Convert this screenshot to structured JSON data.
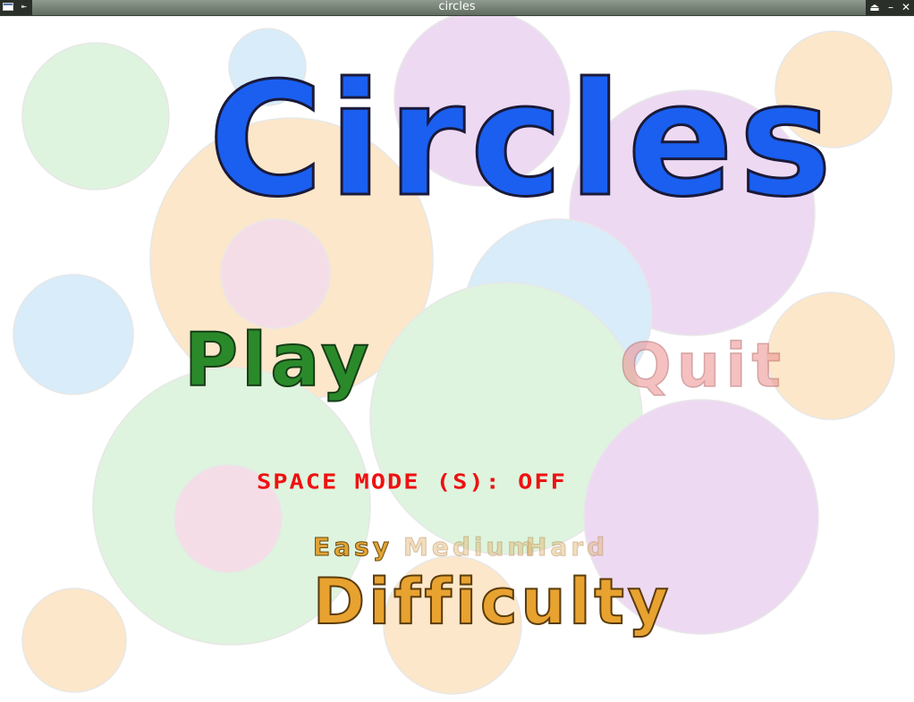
{
  "window": {
    "title": "circles"
  },
  "menu": {
    "title": "Circles",
    "play_label": "Play",
    "quit_label": "Quit",
    "space_mode_label": "SPACE MODE (S): OFF",
    "difficulty_label": "Difficulty",
    "difficulty_options": [
      "Easy",
      "Medium",
      "Hard"
    ],
    "selected_difficulty": "Easy"
  },
  "colors": {
    "title": "#1a5ff0",
    "play": "#2a8a2a",
    "quit": "#eb8c8c",
    "space_mode": "#ee1111",
    "difficulty": "#e8a230",
    "circle_green": "#d4f0d4",
    "circle_blue": "#cfe8fb",
    "circle_pink": "#ecd0f0",
    "circle_peach": "#fde4c4"
  },
  "icons": {
    "window_menu": "window-menu-icon",
    "pin": "pin-icon",
    "eject": "eject-icon",
    "minimize": "minimize-icon",
    "close": "close-icon"
  }
}
